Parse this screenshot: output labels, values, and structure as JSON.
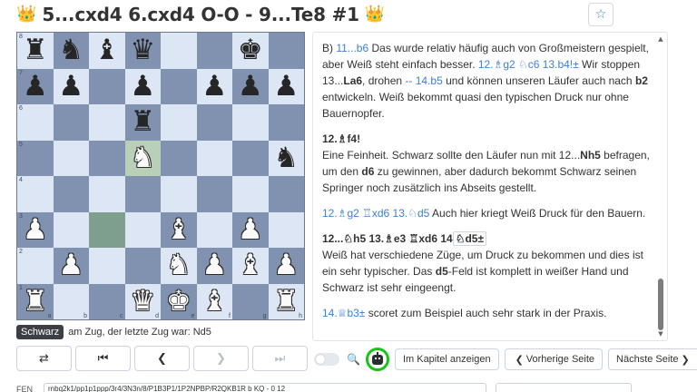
{
  "header": {
    "crown_left": "👑",
    "title": "5...cxd4 6.cxd4 O-O - 9...Te8 #1",
    "crown_right": "👑",
    "favorite_icon": "☆"
  },
  "board": {
    "ranks": [
      "8",
      "7",
      "6",
      "5",
      "4",
      "3",
      "2",
      "1"
    ],
    "files": [
      "a",
      "b",
      "c",
      "d",
      "e",
      "f",
      "g",
      "h"
    ],
    "rows": [
      [
        {
          "p": "♜",
          "c": "b"
        },
        {
          "p": "♞",
          "c": "b"
        },
        {
          "p": "♝",
          "c": "b"
        },
        {
          "p": "♛",
          "c": "b"
        },
        {
          "p": "",
          "c": ""
        },
        {
          "p": "",
          "c": ""
        },
        {
          "p": "♚",
          "c": "b"
        },
        {
          "p": "",
          "c": ""
        }
      ],
      [
        {
          "p": "♟",
          "c": "b"
        },
        {
          "p": "♟",
          "c": "b"
        },
        {
          "p": "",
          "c": ""
        },
        {
          "p": "♟",
          "c": "b"
        },
        {
          "p": "",
          "c": ""
        },
        {
          "p": "♟",
          "c": "b"
        },
        {
          "p": "♟",
          "c": "b"
        },
        {
          "p": "♟",
          "c": "b"
        }
      ],
      [
        {
          "p": "",
          "c": ""
        },
        {
          "p": "",
          "c": ""
        },
        {
          "p": "",
          "c": ""
        },
        {
          "p": "♜",
          "c": "b"
        },
        {
          "p": "",
          "c": ""
        },
        {
          "p": "",
          "c": ""
        },
        {
          "p": "",
          "c": ""
        },
        {
          "p": "",
          "c": ""
        }
      ],
      [
        {
          "p": "",
          "c": ""
        },
        {
          "p": "",
          "c": ""
        },
        {
          "p": "",
          "c": ""
        },
        {
          "p": "♞",
          "c": "w",
          "hl": true
        },
        {
          "p": "",
          "c": ""
        },
        {
          "p": "",
          "c": ""
        },
        {
          "p": "",
          "c": ""
        },
        {
          "p": "♞",
          "c": "b"
        }
      ],
      [
        {
          "p": "",
          "c": ""
        },
        {
          "p": "",
          "c": ""
        },
        {
          "p": "",
          "c": ""
        },
        {
          "p": "",
          "c": ""
        },
        {
          "p": "",
          "c": ""
        },
        {
          "p": "",
          "c": ""
        },
        {
          "p": "",
          "c": ""
        },
        {
          "p": "",
          "c": ""
        }
      ],
      [
        {
          "p": "♟",
          "c": "w"
        },
        {
          "p": "",
          "c": ""
        },
        {
          "p": "",
          "c": "",
          "hl": true
        },
        {
          "p": "",
          "c": ""
        },
        {
          "p": "♝",
          "c": "w"
        },
        {
          "p": "",
          "c": ""
        },
        {
          "p": "♟",
          "c": "w"
        },
        {
          "p": "",
          "c": ""
        }
      ],
      [
        {
          "p": "",
          "c": ""
        },
        {
          "p": "♟",
          "c": "w"
        },
        {
          "p": "",
          "c": ""
        },
        {
          "p": "",
          "c": ""
        },
        {
          "p": "♞",
          "c": "w"
        },
        {
          "p": "♟",
          "c": "w"
        },
        {
          "p": "♝",
          "c": "w"
        },
        {
          "p": "♟",
          "c": "w"
        }
      ],
      [
        {
          "p": "♜",
          "c": "w"
        },
        {
          "p": "",
          "c": ""
        },
        {
          "p": "",
          "c": ""
        },
        {
          "p": "♛",
          "c": "w"
        },
        {
          "p": "♚",
          "c": "w"
        },
        {
          "p": "♝",
          "c": "w"
        },
        {
          "p": "",
          "c": ""
        },
        {
          "p": "♜",
          "c": "w"
        }
      ]
    ]
  },
  "status": {
    "side": "Schwarz",
    "text": "am Zug, der letzte Zug war: Nd5"
  },
  "nav": {
    "flip_icon": "⇄",
    "first_icon": "⏮",
    "prev_icon": "❮",
    "next_icon": "❯",
    "last_icon": "⏭"
  },
  "annotation": {
    "p1": {
      "a": "B) ",
      "m1": "11...b6",
      "b": " Das wurde relativ häufig auch von Großmeistern gespielt, aber Weiß steht einfach besser. ",
      "m2": "12.♗g2 ♘c6 13.b4!±",
      "c": " Wir stoppen 13...",
      "d": "La6",
      "e": ", drohen ",
      "m3": "-- 14.b5",
      "f": " und können unseren Läufer auch nach ",
      "g": "b2",
      "h": " entwickeln. Weiß bekommt quasi den typischen Druck nur ohne Bauernopfer."
    },
    "p2_move": "12.♗f4!",
    "p3": {
      "a": "Eine Feinheit. Schwarz sollte den Läufer nun mit 12...",
      "b": "Nh5",
      "c": " befragen, um den ",
      "d": "d6",
      "e": " zu gewinnen, aber dadurch bekommt Schwarz seinen Springer noch zusätzlich ins Abseits gestellt."
    },
    "p4": {
      "m": "12.♗g2 ♖xd6 13.♘d5",
      "t": " Auch hier kriegt Weiß Druck für den Bauern."
    },
    "p5_moves": {
      "a": "12...♘h5  13.♗e3  ♖xd6  14",
      "b": "♘d5±"
    },
    "p6": {
      "a": "Weiß hat verschiedene Züge, um Druck zu bekommen und dies ist ein sehr typischer. Das ",
      "b": "d5",
      "c": "-Feld ist komplett in weißer Hand und Schwarz ist sehr eingeengt."
    },
    "p7": {
      "m": "14.♕b3±",
      "t": " scoret zum Beispiel auch sehr stark in der Praxis."
    }
  },
  "toolbar": {
    "zoom_icon": "🔍",
    "chapter_label": "Im Kapitel anzeigen",
    "prev_page_label": "Vorherige Seite",
    "next_page_label": "Nächste Seite",
    "prev_chev": "❮",
    "next_chev": "❯"
  },
  "fen": {
    "label": "FEN",
    "value": "rnbq2k1/pp1p1ppp/3r4/3N3n/8/P1B3P1/1P2NPBP/R2QKB1R b KQ - 0 12"
  }
}
